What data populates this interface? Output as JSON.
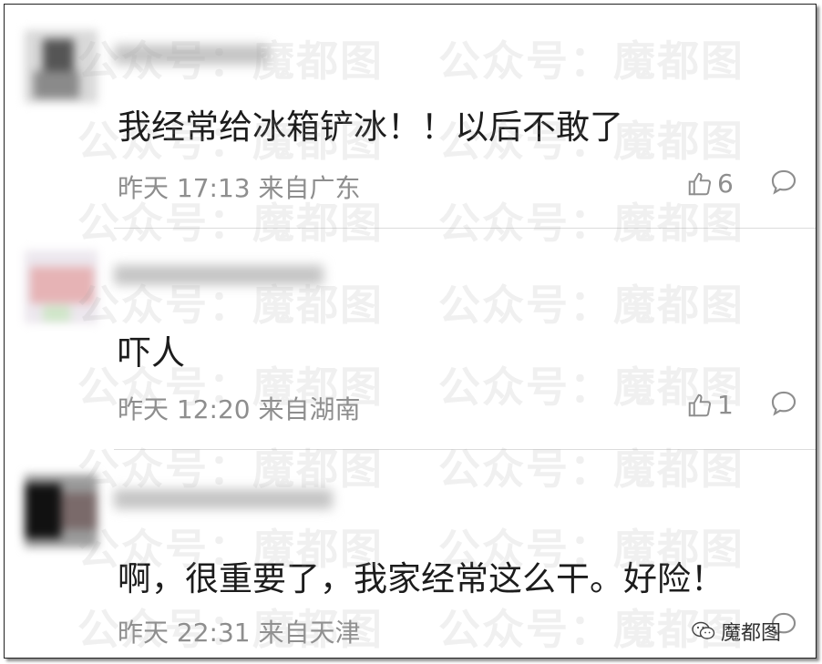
{
  "watermark_text": "公众号：魔都图",
  "comments": [
    {
      "text": "我经常给冰箱铲冰！！以后不敢了",
      "meta": "昨天 17:13 来自广东",
      "likes": "6"
    },
    {
      "text": "吓人",
      "meta": "昨天 12:20 来自湖南",
      "likes": "1"
    },
    {
      "text": "啊，很重要了，我家经常这么干。好险！",
      "meta": "昨天 22:31 来自天津"
    }
  ],
  "brand": {
    "label": "魔都图",
    "icon": "wechat-icon"
  },
  "colors": {
    "meta": "#8e8e8e",
    "text": "#1c1c1c",
    "divider": "#dcdcdc"
  }
}
